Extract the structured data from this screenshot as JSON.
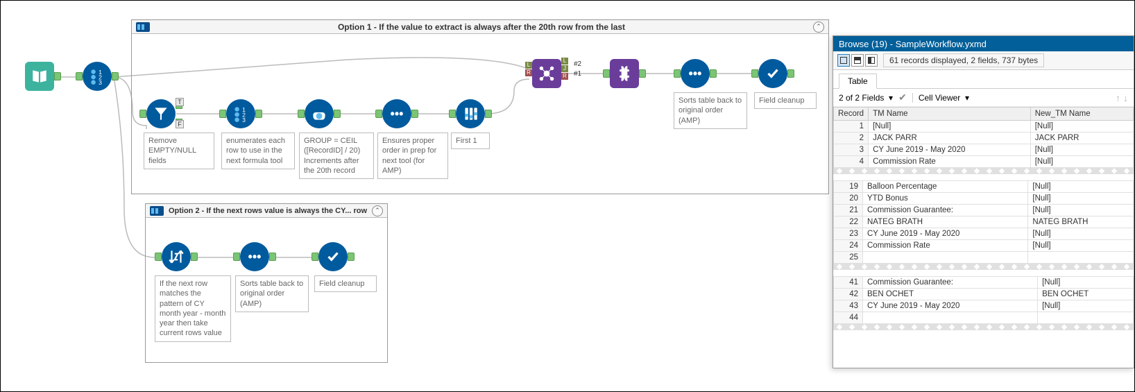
{
  "canvas": {
    "container1": {
      "title": "Option 1 - If the value to extract is always after the 20th row from the last"
    },
    "container2": {
      "title": "Option 2 - If the next rows value is always the CY... row"
    },
    "tools": {
      "input_label": "",
      "recordid1_label": "",
      "filter_label": "Remove EMPTY/NULL fields",
      "recordid2_label": "enumerates each row to use in the next formula tool",
      "formula_label": "GROUP = CEIL ([RecordID] / 20) Increments after the 20th record",
      "sort1_label": "Ensures proper order in prep for next tool (for AMP)",
      "sample_label": "First 1",
      "join_label": "",
      "join_out2": "#2",
      "join_out1": "#1",
      "findreplace_label": "",
      "sort2_label": "Sorts table back to original order (AMP)",
      "select1_label": "Field cleanup",
      "multirow_label": "If the next row matches the pattern of CY month year - month year then take current rows value",
      "sort3_label": "Sorts table back to original order (AMP)",
      "select2_label": "Field cleanup"
    }
  },
  "results": {
    "title": "Browse (19) - SampleWorkflow.yxmd",
    "records_info": "61 records displayed, 2 fields, 737 bytes",
    "tab_label": "Table",
    "fields_dropdown": "2 of 2 Fields",
    "cell_viewer": "Cell Viewer",
    "columns": {
      "col0": "Record",
      "col1": "TM Name",
      "col2": "New_TM Name"
    },
    "section1": [
      {
        "n": "1",
        "c1": "[Null]",
        "c2": "[Null]"
      },
      {
        "n": "2",
        "c1": "JACK PARR",
        "c2": "JACK PARR"
      },
      {
        "n": "3",
        "c1": "CY June 2019 - May 2020",
        "c2": "[Null]"
      },
      {
        "n": "4",
        "c1": "Commission Rate",
        "c2": "[Null]"
      }
    ],
    "section2": [
      {
        "n": "19",
        "c1": "Balloon Percentage",
        "c2": "[Null]"
      },
      {
        "n": "20",
        "c1": "YTD Bonus",
        "c2": "[Null]"
      },
      {
        "n": "21",
        "c1": "Commission Guarantee:",
        "c2": "[Null]"
      },
      {
        "n": "22",
        "c1": "NATEG BRATH",
        "c2": "NATEG BRATH"
      },
      {
        "n": "23",
        "c1": "CY June 2019 - May 2020",
        "c2": "[Null]"
      },
      {
        "n": "24",
        "c1": "Commission Rate",
        "c2": "[Null]"
      },
      {
        "n": "25",
        "c1": "",
        "c2": ""
      }
    ],
    "section3": [
      {
        "n": "41",
        "c1": "Commission Guarantee:",
        "c2": "[Null]"
      },
      {
        "n": "42",
        "c1": "BEN OCHET",
        "c2": "BEN OCHET"
      },
      {
        "n": "43",
        "c1": "CY June 2019 - May 2020",
        "c2": "[Null]"
      },
      {
        "n": "44",
        "c1": "",
        "c2": ""
      }
    ]
  }
}
